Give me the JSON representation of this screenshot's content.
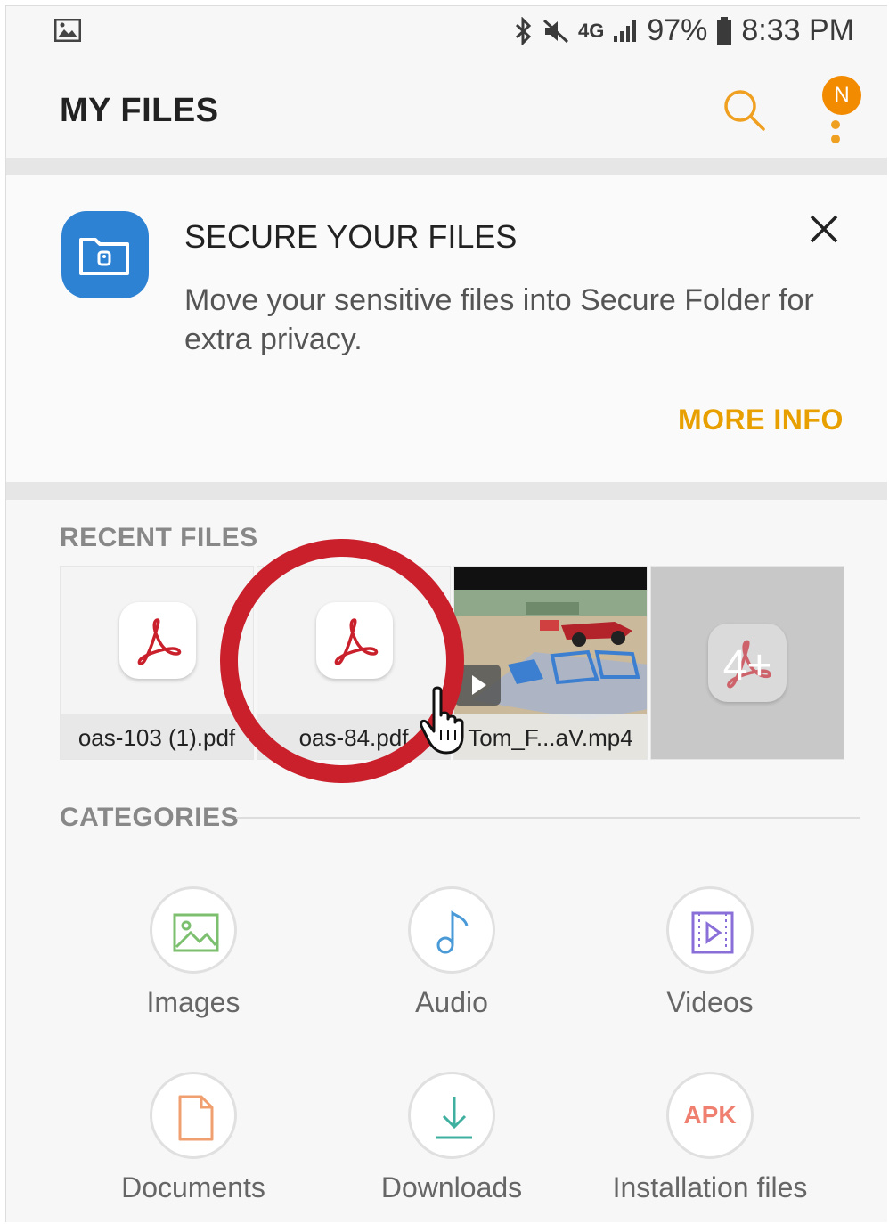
{
  "status_bar": {
    "network": "4G",
    "battery": "97%",
    "time": "8:33 PM",
    "icons": [
      "gallery-icon",
      "bluetooth-icon",
      "mute-icon",
      "lte-icon",
      "signal-icon",
      "battery-icon"
    ]
  },
  "app_bar": {
    "title": "MY FILES",
    "notification_badge": "N",
    "accent": "#f28b00"
  },
  "secure_card": {
    "heading": "SECURE YOUR FILES",
    "description": "Move your sensitive files into Secure Folder for extra privacy.",
    "action": "MORE INFO",
    "action_color": "#e8a000",
    "icon_color": "#2d82d4"
  },
  "recent_files": {
    "title": "RECENT FILES",
    "items": [
      {
        "name": "oas-103 (1).pdf",
        "type": "pdf"
      },
      {
        "name": "oas-84.pdf",
        "type": "pdf"
      },
      {
        "name": "Tom_F...aV.mp4",
        "type": "video"
      },
      {
        "name": "",
        "type": "more",
        "count": "4+"
      }
    ],
    "highlight_color": "#c9202c"
  },
  "categories": {
    "title": "CATEGORIES",
    "items": [
      {
        "label": "Images",
        "icon": "image-icon",
        "color": "#7cc06f"
      },
      {
        "label": "Audio",
        "icon": "music-note-icon",
        "color": "#4a9ad8"
      },
      {
        "label": "Videos",
        "icon": "video-icon",
        "color": "#8a6fd8"
      },
      {
        "label": "Documents",
        "icon": "document-icon",
        "color": "#f0a070"
      },
      {
        "label": "Downloads",
        "icon": "download-icon",
        "color": "#3fb0a0"
      },
      {
        "label": "Installation files",
        "icon": "apk-icon",
        "icon_text": "APK",
        "color": "#ef8070"
      }
    ]
  }
}
